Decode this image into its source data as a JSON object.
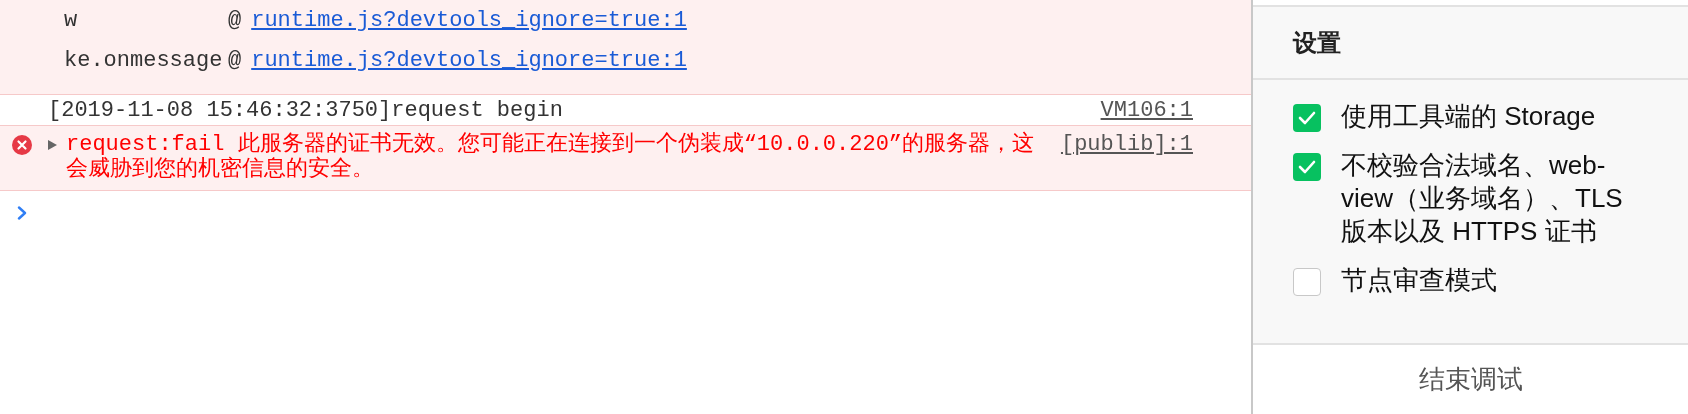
{
  "console": {
    "stack_frames": [
      {
        "function": "w",
        "at": "@",
        "link": "runtime.js?devtools_ignore=true:1"
      },
      {
        "function": "ke.onmessage",
        "at": "@",
        "link": "runtime.js?devtools_ignore=true:1"
      }
    ],
    "messages": [
      {
        "kind": "log",
        "text": "[2019-11-08 15:46:32:3750]request begin",
        "source": "VM106:1"
      },
      {
        "kind": "error",
        "expanded": false,
        "text": "request:fail 此服务器的证书无效。您可能正在连接到一个伪装成“10.0.0.220”的服务器，这会威胁到您的机密信息的安全。",
        "source": "[publib]:1"
      }
    ]
  },
  "settings": {
    "title": "设置",
    "options": [
      {
        "label": "使用工具端的 Storage",
        "checked": true
      },
      {
        "label": "不校验合法域名、web-view（业务域名）、TLS 版本以及 HTTPS 证书",
        "checked": true
      },
      {
        "label": "节点审查模式",
        "checked": false
      }
    ],
    "button": "结束调试"
  }
}
